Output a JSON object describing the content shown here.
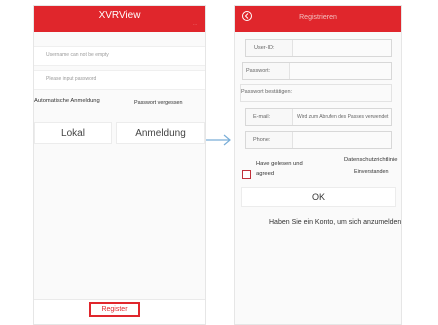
{
  "colors": {
    "accent": "#e0262c",
    "arrow": "#7aaed8"
  },
  "login": {
    "header_title": "XVRView",
    "header_sub": "···",
    "username_placeholder": "Username can not be empty",
    "password_placeholder": "Please input password",
    "auto_login_label": "Automatische Anmeldung",
    "forgot_password_label": "Passwort vergessen",
    "local_button": "Lokal",
    "login_button": "Anmeldung",
    "register_link": "Register"
  },
  "register": {
    "header_title": "Registrieren",
    "userid_label": "User-ID:",
    "password_label": "Passwort:",
    "password_confirm_label": "Passwort bestätigen:",
    "email_label": "E-mail:",
    "email_hint": "Wird zum Abrufen des Passes verwendet",
    "phone_label": "Phone:",
    "agree_text_1": "Have gelesen und",
    "agree_text_2": "agreed",
    "privacy_text_1": "Datenschutzrichtlinie",
    "privacy_text_2": "Einverstanden",
    "ok_button": "OK",
    "account_link": "Haben Sie ein Konto, um sich anzumelden"
  }
}
